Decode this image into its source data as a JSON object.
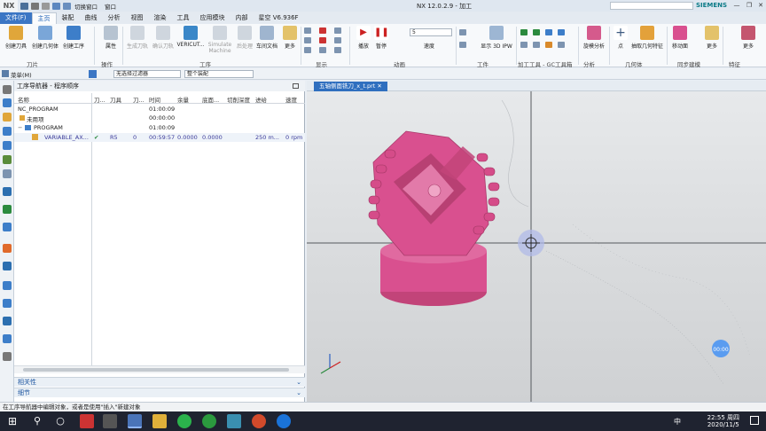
{
  "window": {
    "logo": "NX",
    "title": "NX 12.0.2.9 - 加工",
    "quick_access": "切换窗口",
    "window_menu": "窗口",
    "brand": "SIEMENS"
  },
  "menu_tabs": [
    "文件(F)",
    "主页",
    "装配",
    "曲线",
    "分析",
    "视图",
    "渲染",
    "工具",
    "应用模块",
    "内部",
    "星空 V6.936F"
  ],
  "ribbon": {
    "buttons": [
      {
        "label": "创建刀具",
        "icon": "create-tool-icon"
      },
      {
        "label": "创建几何体",
        "icon": "create-geometry-icon"
      },
      {
        "label": "创建工序",
        "icon": "create-operation-icon"
      },
      {
        "label": "属性",
        "icon": "properties-icon"
      },
      {
        "label": "生成刀轨",
        "icon": "generate-path-icon"
      },
      {
        "label": "确认刀轨",
        "icon": "verify-path-icon"
      },
      {
        "label": "VERICUT...",
        "icon": "vericut-icon"
      },
      {
        "label": "Simulate Machine",
        "icon": "simulate-machine-icon"
      },
      {
        "label": "后处理",
        "icon": "postprocess-icon"
      },
      {
        "label": "车间文档",
        "icon": "shop-doc-icon"
      },
      {
        "label": "更多",
        "icon": "more-icon"
      },
      {
        "label": "播放",
        "icon": "play-icon"
      },
      {
        "label": "暂停",
        "icon": "pause-icon"
      },
      {
        "label": "显示 3D IPW",
        "icon": "ipw-icon"
      },
      {
        "label": "旋模分析",
        "icon": "analysis-icon"
      },
      {
        "label": "点",
        "icon": "point-icon"
      },
      {
        "label": "抽取几何特征",
        "icon": "extract-geometry-icon"
      },
      {
        "label": "移动面",
        "icon": "move-face-icon"
      },
      {
        "label": "更多",
        "icon": "more-icon"
      },
      {
        "label": "更多",
        "icon": "more-icon"
      }
    ],
    "speed_value": "5",
    "speed_label": "速度",
    "groups": [
      "刀片",
      "操作",
      "工序",
      "显示",
      "动画",
      "工件",
      "加工工具 - GC工具箱",
      "分析",
      "几何体",
      "同步建模",
      "特征"
    ]
  },
  "filter_bar": {
    "menu": "菜单(M)",
    "filter": "无选择过滤器",
    "scope": "整个装配"
  },
  "navigator": {
    "title": "工序导航器 - 程序顺序",
    "columns": [
      "名称",
      "刀...",
      "刀具",
      "刀...",
      "时间",
      "余量",
      "底面...",
      "切削深度",
      "进给",
      "速度"
    ],
    "rows": [
      {
        "name": "NC_PROGRAM",
        "check": "",
        "tool": "",
        "num": "",
        "time": "01:00:09",
        "stock": "",
        "floor": "",
        "depth": "",
        "feed": "",
        "speed": ""
      },
      {
        "name": "未用项",
        "check": "",
        "tool": "",
        "num": "",
        "time": "00:00:00",
        "stock": "",
        "floor": "",
        "depth": "",
        "feed": "",
        "speed": ""
      },
      {
        "name": "PROGRAM",
        "check": "",
        "tool": "",
        "num": "",
        "time": "01:00:09",
        "stock": "",
        "floor": "",
        "depth": "",
        "feed": "",
        "speed": ""
      },
      {
        "name": "VARIABLE_AX...",
        "check": "✔",
        "tool": "R5",
        "num": "0",
        "time": "00:59:57",
        "stock": "0.0000",
        "floor": "0.0000",
        "depth": "",
        "feed": "250 m...",
        "speed": "0 rpm"
      }
    ],
    "panels": [
      "相关性",
      "细节"
    ]
  },
  "viewport": {
    "tab_label": "五轴侧面铣刀_x_t.prt",
    "badge": "00:00"
  },
  "status_bar": "在工序导航器中编辑对象，或者是使用\"插入\"新建对象",
  "taskbar": {
    "time": "22:55 周四",
    "date": "2020/11/5",
    "ime": "中"
  },
  "colors": {
    "part": "#d9508f",
    "accent": "#3b76c4"
  }
}
